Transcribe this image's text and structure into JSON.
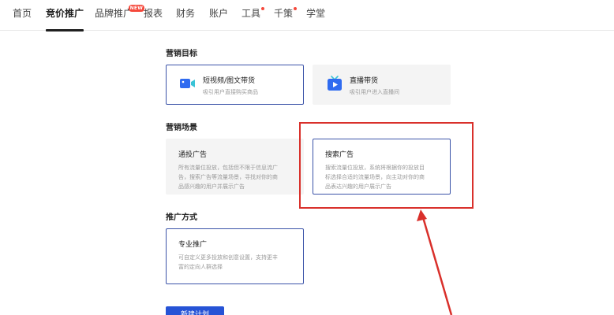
{
  "nav": {
    "items": [
      {
        "label": "首页"
      },
      {
        "label": "竞价推广",
        "active": true
      },
      {
        "label": "品牌推广",
        "badge": "NEW"
      },
      {
        "label": "报表"
      },
      {
        "label": "财务"
      },
      {
        "label": "账户"
      },
      {
        "label": "工具",
        "dot": true
      },
      {
        "label": "千策",
        "dot": true
      },
      {
        "label": "学堂"
      }
    ]
  },
  "sections": {
    "goal": {
      "title": "营销目标",
      "cards": [
        {
          "title": "短视频/图文带货",
          "desc": "吸引用户直接购买商品",
          "icon": "video-camera-icon",
          "selected": true
        },
        {
          "title": "直播带货",
          "desc": "吸引用户进入直播间",
          "icon": "live-tv-icon",
          "selected": false
        }
      ]
    },
    "scene": {
      "title": "营销场景",
      "cards": [
        {
          "title": "通投广告",
          "desc": [
            "所有流量位投放，包括但不限于信息流广",
            "告，搜索广告等流量场景，寻找对你的商",
            "品感兴趣的用户并展示广告"
          ],
          "selected": false
        },
        {
          "title": "搜索广告",
          "desc": [
            "搜索流量位投放，系统将根据你的投放目",
            "标选择合适的流量场景，向主动对你的商",
            "品表达兴趣的用户展示广告"
          ],
          "selected": true
        }
      ]
    },
    "method": {
      "title": "推广方式",
      "cards": [
        {
          "title": "专业推广",
          "desc": [
            "可自定义更多投放和创意设置，支持更丰",
            "富的定向人群选择"
          ],
          "selected": true
        }
      ]
    }
  },
  "create_button": {
    "label": "新建计划"
  },
  "colors": {
    "accent": "#2653d6",
    "selected_border": "#3b53a8",
    "annotation_red": "#d9302b",
    "badge_red": "#f5483b",
    "card_bg": "#f4f4f4"
  }
}
